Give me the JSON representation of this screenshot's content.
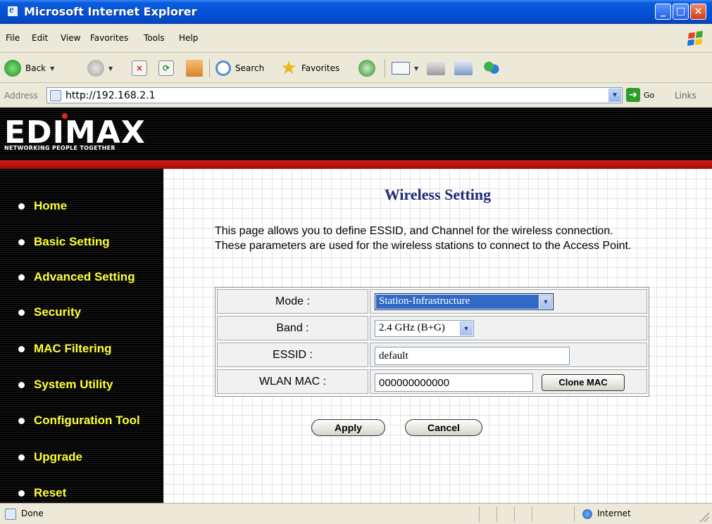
{
  "window": {
    "title": "Microsoft Internet Explorer"
  },
  "menu": [
    "File",
    "Edit",
    "View",
    "Favorites",
    "Tools",
    "Help"
  ],
  "toolbar": {
    "back_label": "Back",
    "search_label": "Search",
    "favorites_label": "Favorites"
  },
  "address": {
    "label": "Address",
    "url": "http://192.168.2.1",
    "go_label": "Go",
    "links_label": "Links"
  },
  "brand": {
    "logo": "EDIMAX",
    "tagline": "NETWORKING PEOPLE TOGETHER"
  },
  "nav": [
    "Home",
    "Basic Setting",
    "Advanced Setting",
    "Security",
    "MAC Filtering",
    "System Utility",
    "Configuration Tool",
    "Upgrade",
    "Reset"
  ],
  "page": {
    "title": "Wireless Setting",
    "description": "This page allows you to define ESSID, and Channel for the wireless connection. These parameters are used for the wireless stations to connect to the Access Point."
  },
  "form": {
    "mode": {
      "label": "Mode :",
      "value": "Station-Infrastructure"
    },
    "band": {
      "label": "Band :",
      "value": "2.4 GHz (B+G)"
    },
    "essid": {
      "label": "ESSID :",
      "value": "default"
    },
    "wlan_mac": {
      "label": "WLAN MAC :",
      "value": "000000000000",
      "clone_label": "Clone MAC"
    }
  },
  "buttons": {
    "apply": "Apply",
    "cancel": "Cancel"
  },
  "status": {
    "text": "Done",
    "zone": "Internet"
  },
  "colors": {
    "title_blue": "#0553d6",
    "nav_yellow": "#ffff33",
    "banner_red": "#d11b14",
    "heading_navy": "#1d2b77",
    "selection_blue": "#316ac5"
  },
  "icons": [
    "ie-icon",
    "minimize-icon",
    "maximize-icon",
    "close-icon",
    "windows-logo-icon",
    "back-icon",
    "forward-icon",
    "stop-icon",
    "refresh-icon",
    "home-icon",
    "search-icon",
    "favorites-star-icon",
    "history-icon",
    "mail-icon",
    "print-icon",
    "edit-icon",
    "messenger-icon",
    "page-icon",
    "go-icon",
    "internet-zone-icon"
  ]
}
